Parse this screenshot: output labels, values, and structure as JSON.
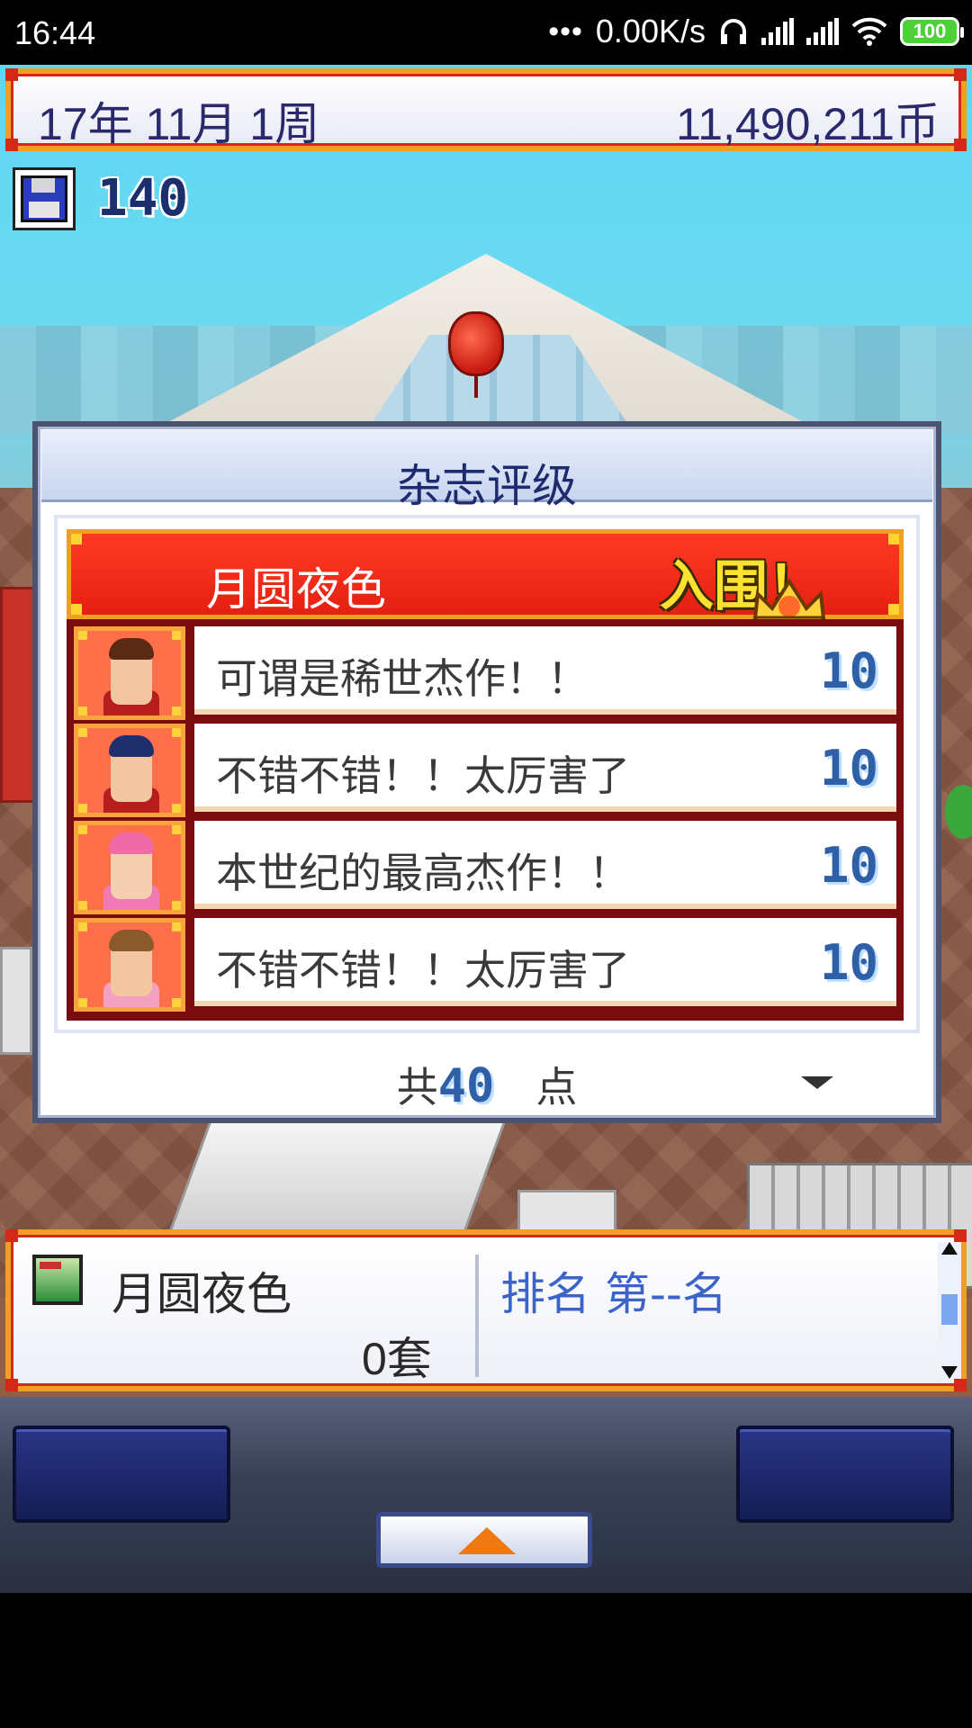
{
  "status_bar": {
    "time": "16:44",
    "net_speed": "0.00K/s",
    "battery": "100"
  },
  "top_bar": {
    "date": "17年 11月 1周",
    "money": "11,490,211币"
  },
  "save": {
    "count": "140"
  },
  "dialog": {
    "title": "杂志评级",
    "magazine_name": "月圆夜色",
    "status_badge": "入围！",
    "reviews": [
      {
        "comment": "可谓是稀世杰作！！",
        "score": "10",
        "face_color": "#f2c6a0",
        "hair_color": "#5a2a14",
        "shirt_color": "#b81d1d"
      },
      {
        "comment": "不错不错！！太厉害了",
        "score": "10",
        "face_color": "#f2c6a0",
        "hair_color": "#1e2f6e",
        "shirt_color": "#b81d1d"
      },
      {
        "comment": "本世纪的最高杰作！！",
        "score": "10",
        "face_color": "#f6cfb0",
        "hair_color": "#f06aa8",
        "shirt_color": "#f27ab4"
      },
      {
        "comment": "不错不错！！太厉害了",
        "score": "10",
        "face_color": "#f2c6a0",
        "hair_color": "#8a5a2a",
        "shirt_color": "#f4a0c0"
      }
    ],
    "total_prefix": "共",
    "total_points": "40",
    "total_suffix": "点"
  },
  "info_panel": {
    "magazine_name": "月圆夜色",
    "copies": "0套",
    "rank": "排名 第--名"
  },
  "colors": {
    "accent_red": "#e61f12",
    "frame_orange": "#f0a020",
    "score_blue": "#2f5fa6",
    "rank_blue": "#3b63c8"
  }
}
